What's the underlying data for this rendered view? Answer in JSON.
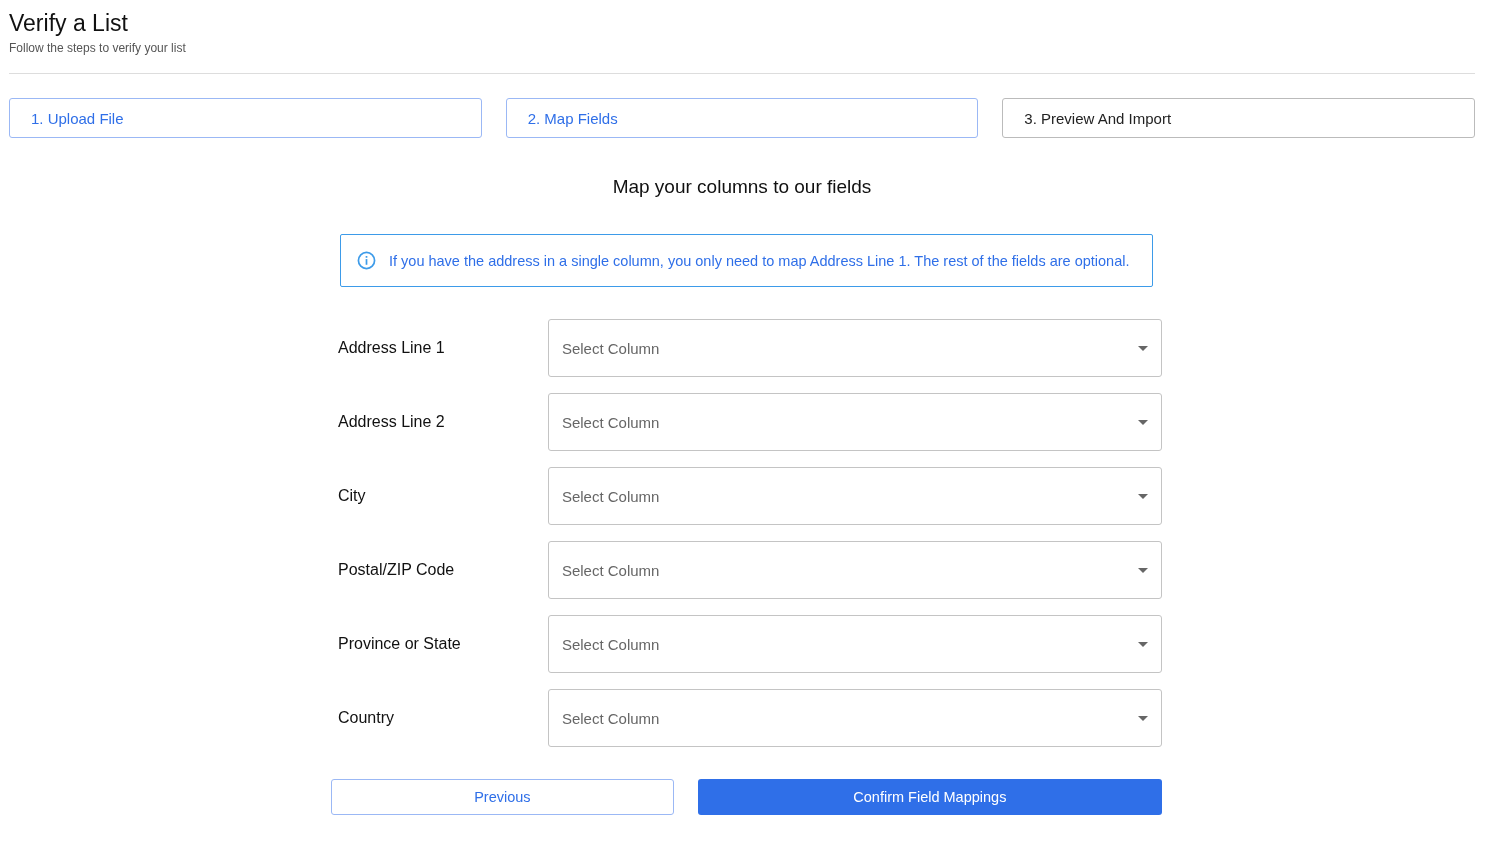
{
  "header": {
    "title": "Verify a List",
    "subtitle": "Follow the steps to verify your list"
  },
  "steps": [
    {
      "label": "1. Upload File",
      "reached": true
    },
    {
      "label": "2. Map Fields",
      "reached": true
    },
    {
      "label": "3. Preview And Import",
      "reached": false
    }
  ],
  "heading": "Map your columns to our fields",
  "info": "If you have the address in a single column, you only need to map Address Line 1. The rest of the fields are optional.",
  "mappings": [
    {
      "label": "Address Line 1",
      "placeholder": "Select Column"
    },
    {
      "label": "Address Line 2",
      "placeholder": "Select Column"
    },
    {
      "label": "City",
      "placeholder": "Select Column"
    },
    {
      "label": "Postal/ZIP Code",
      "placeholder": "Select Column"
    },
    {
      "label": "Province or State",
      "placeholder": "Select Column"
    },
    {
      "label": "Country",
      "placeholder": "Select Column"
    }
  ],
  "buttons": [
    {
      "label": "Previous",
      "kind": "outline"
    },
    {
      "label": "Confirm Field Mappings",
      "kind": "primary"
    }
  ]
}
